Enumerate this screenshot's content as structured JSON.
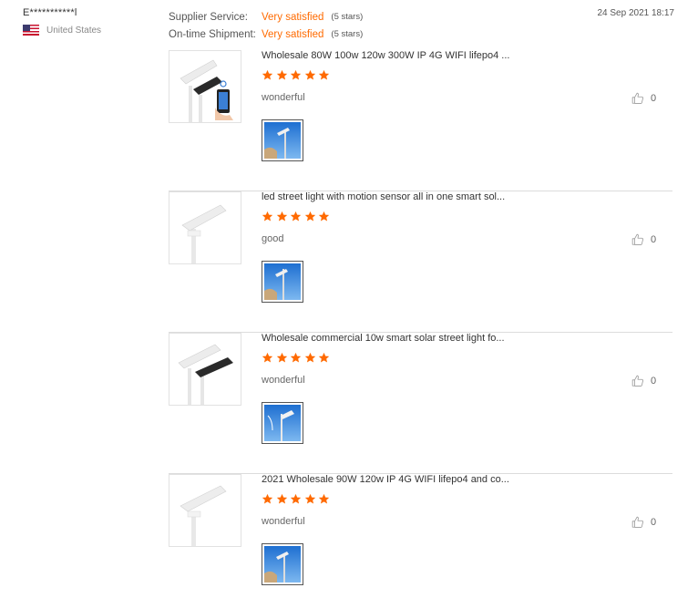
{
  "reviewer": {
    "name": "E***********l",
    "country": "United States"
  },
  "ratings": [
    {
      "label": "Supplier Service:",
      "value": "Very satisfied",
      "stars_text": "(5 stars)"
    },
    {
      "label": "On-time Shipment:",
      "value": "Very satisfied",
      "stars_text": "(5 stars)"
    }
  ],
  "date": "24 Sep 2021 18:17",
  "colors": {
    "accent": "#ff6a00",
    "divider": "#dcdcdc"
  },
  "reviews": [
    {
      "product_title": "Wholesale 80W 100w 120w 300W IP 4G WIFI lifepo4 ...",
      "rating": 5,
      "comment": "wonderful",
      "helpful_icon": "thumbs-up-icon",
      "helpful_count": "0"
    },
    {
      "product_title": "led street light with motion sensor all in one smart sol...",
      "rating": 5,
      "comment": "good",
      "helpful_icon": "thumbs-up-icon",
      "helpful_count": "0"
    },
    {
      "product_title": "Wholesale commercial 10w smart solar street light fo...",
      "rating": 5,
      "comment": "wonderful",
      "helpful_icon": "thumbs-up-icon",
      "helpful_count": "0"
    },
    {
      "product_title": "2021 Wholesale 90W 120w IP 4G WIFI lifepo4 and co...",
      "rating": 5,
      "comment": "wonderful",
      "helpful_icon": "thumbs-up-icon",
      "helpful_count": "0"
    }
  ]
}
